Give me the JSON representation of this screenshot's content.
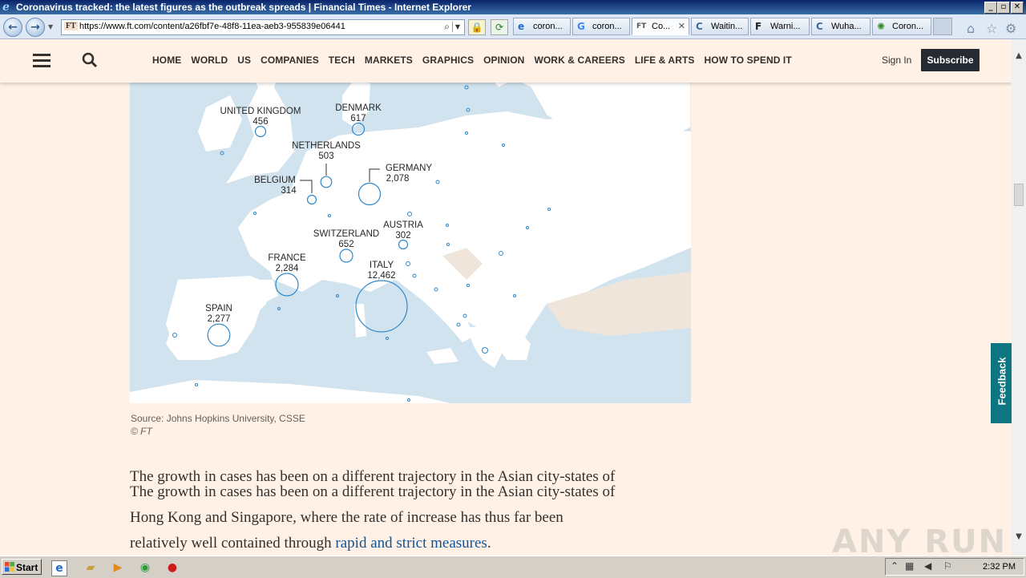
{
  "window": {
    "title": "Coronavirus tracked: the latest figures as the outbreak spreads | Financial Times - Internet Explorer"
  },
  "browser": {
    "url": "https://www.ft.com/content/a26fbf7e-48f8-11ea-aeb3-955839e06441",
    "favicon_text": "FT",
    "tabs": [
      {
        "label": "coron...",
        "icon": "ie-icon"
      },
      {
        "label": "coron...",
        "icon": "google-icon"
      },
      {
        "label": "Co...",
        "icon": "ft-icon",
        "active": true
      },
      {
        "label": "Waitin...",
        "icon": "loading-icon"
      },
      {
        "label": "Warni...",
        "icon": "f-icon"
      },
      {
        "label": "Wuha...",
        "icon": "loading-icon"
      },
      {
        "label": "Coron...",
        "icon": "virus-icon"
      }
    ]
  },
  "ft_nav": {
    "links": [
      "HOME",
      "WORLD",
      "US",
      "COMPANIES",
      "TECH",
      "MARKETS",
      "GRAPHICS",
      "OPINION",
      "WORK & CAREERS",
      "LIFE & ARTS",
      "HOW TO SPEND IT"
    ],
    "sign_in": "Sign In",
    "subscribe": "Subscribe"
  },
  "map": {
    "countries": [
      {
        "name": "UNITED KINGDOM",
        "cases": "456"
      },
      {
        "name": "DENMARK",
        "cases": "617"
      },
      {
        "name": "NETHERLANDS",
        "cases": "503"
      },
      {
        "name": "GERMANY",
        "cases": "2,078"
      },
      {
        "name": "BELGIUM",
        "cases": "314"
      },
      {
        "name": "AUSTRIA",
        "cases": "302"
      },
      {
        "name": "SWITZERLAND",
        "cases": "652"
      },
      {
        "name": "FRANCE",
        "cases": "2,284"
      },
      {
        "name": "ITALY",
        "cases": "12,462"
      },
      {
        "name": "SPAIN",
        "cases": "2,277"
      }
    ],
    "colors": {
      "sea": "#d1e3ee",
      "land": "#ffffff",
      "marker": "#2f87c9",
      "non_eu": "#efe5da"
    }
  },
  "source": "Source: Johns Hopkins University, CSSE",
  "copyright": "© FT",
  "article": {
    "line1": "The growth in cases has been on a different trajectory in the Asian city-states of",
    "line1_dup": "The growth in cases has been on a different trajectory in the Asian city-states of",
    "line2": "Hong Kong and Singapore, where the rate of increase has thus far been",
    "line3_text": "relatively well contained through ",
    "line3_link": "rapid and strict measures",
    "line3_end": "."
  },
  "feedback": "Feedback",
  "watermark": "ANY RUN",
  "taskbar": {
    "start": "Start",
    "clock": "2:32 PM"
  }
}
